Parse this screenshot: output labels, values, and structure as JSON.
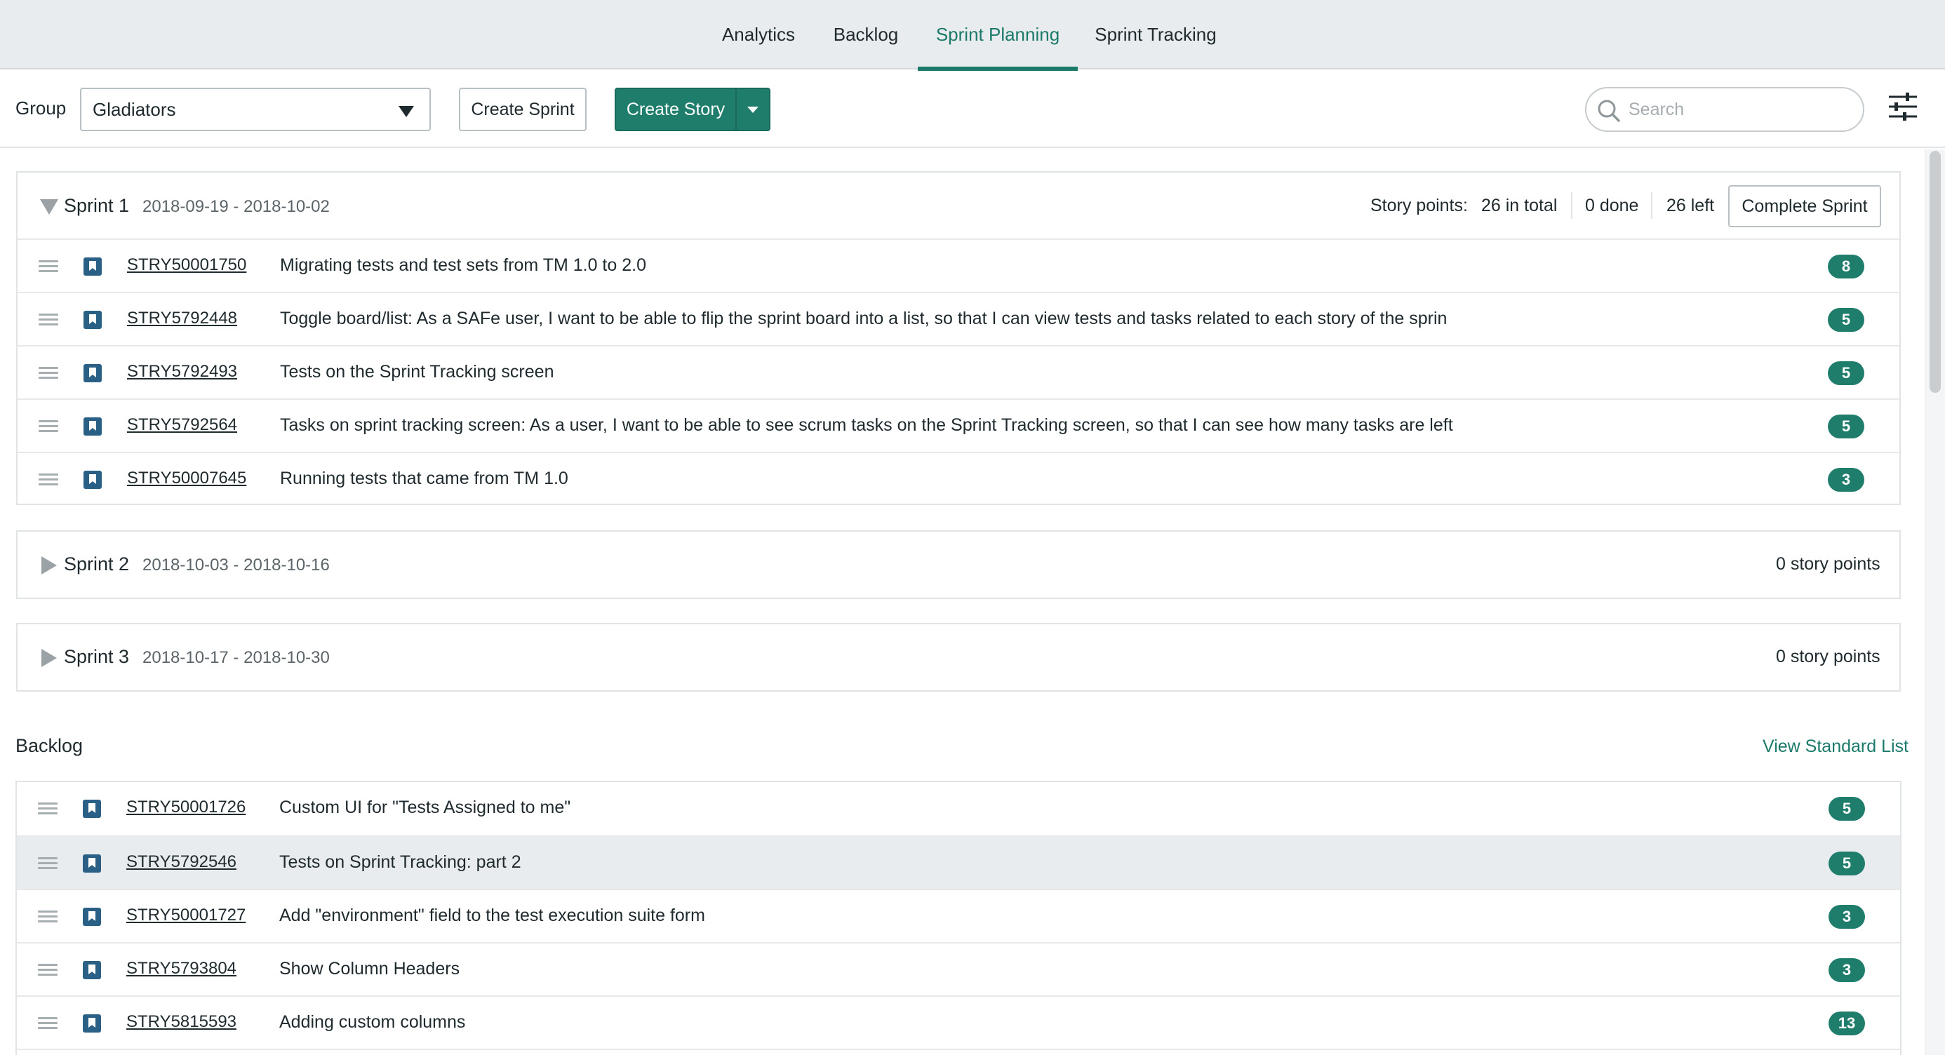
{
  "nav": {
    "tabs": [
      {
        "label": "Analytics"
      },
      {
        "label": "Backlog"
      },
      {
        "label": "Sprint Planning",
        "active": true
      },
      {
        "label": "Sprint Tracking"
      }
    ]
  },
  "toolbar": {
    "group_label": "Group",
    "group_value": "Gladiators",
    "create_sprint": "Create Sprint",
    "create_story": "Create Story",
    "search_placeholder": "Search"
  },
  "sprints": [
    {
      "name": "Sprint 1",
      "dates": "2018-09-19 - 2018-10-02",
      "expanded": true,
      "points_label": "Story points:",
      "total": "26 in total",
      "done": "0 done",
      "left": "26 left",
      "complete_button": "Complete Sprint",
      "stories": [
        {
          "id": "STRY50001750",
          "title": "Migrating tests and test sets from TM 1.0 to 2.0",
          "points": "8"
        },
        {
          "id": "STRY5792448",
          "title": "Toggle board/list: As a SAFe user, I want to be able to flip the sprint board into a list, so that I can view tests and tasks related to each story of the sprin",
          "points": "5"
        },
        {
          "id": "STRY5792493",
          "title": "Tests on the Sprint Tracking screen",
          "points": "5"
        },
        {
          "id": "STRY5792564",
          "title": "Tasks on sprint tracking screen: As a user, I want to be able to see scrum tasks on the Sprint Tracking screen, so that I can see how many tasks are left",
          "points": "5"
        },
        {
          "id": "STRY50007645",
          "title": "Running tests that came from TM 1.0",
          "points": "3"
        }
      ]
    },
    {
      "name": "Sprint 2",
      "dates": "2018-10-03 - 2018-10-16",
      "expanded": false,
      "summary": "0 story points"
    },
    {
      "name": "Sprint 3",
      "dates": "2018-10-17 - 2018-10-30",
      "expanded": false,
      "summary": "0 story points"
    }
  ],
  "backlog": {
    "title": "Backlog",
    "view_standard_list": "View Standard List",
    "stories": [
      {
        "id": "STRY50001726",
        "title": "Custom UI for \"Tests Assigned to me\"",
        "points": "5"
      },
      {
        "id": "STRY5792546",
        "title": "Tests on Sprint Tracking: part 2",
        "points": "5",
        "highlighted": true
      },
      {
        "id": "STRY50001727",
        "title": "Add \"environment\" field to the test execution suite form",
        "points": "3"
      },
      {
        "id": "STRY5793804",
        "title": "Show Column Headers",
        "points": "3"
      },
      {
        "id": "STRY5815593",
        "title": "Adding custom columns",
        "points": "13"
      }
    ]
  },
  "colors": {
    "accent": "#1f7d6c",
    "story_icon": "#2a5f86",
    "nav_bg": "#e9ecee"
  },
  "icons": [
    "search-icon",
    "filter-settings-icon",
    "drag-handle-icon",
    "story-bookmark-icon",
    "dropdown-caret-icon",
    "expand-triangle-icon"
  ]
}
